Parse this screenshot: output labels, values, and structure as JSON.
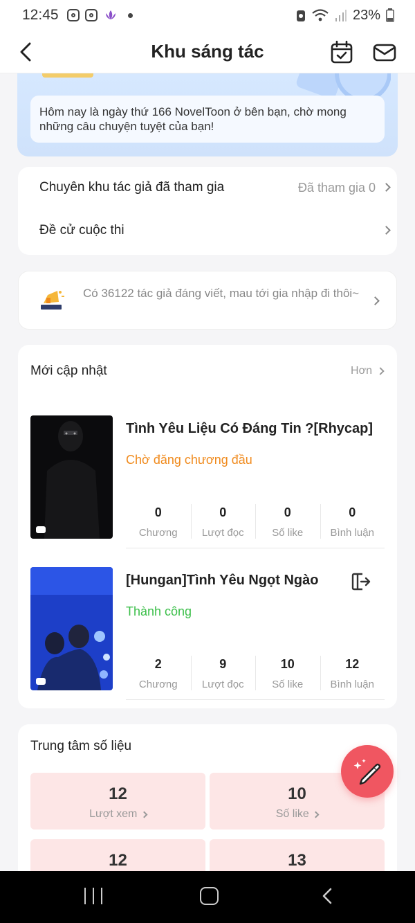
{
  "status_bar": {
    "time": "12:45",
    "battery": "23%"
  },
  "header": {
    "title": "Khu sáng tác"
  },
  "banner": {
    "message": "Hôm nay là ngày thứ 166 NovelToon ở bên bạn, chờ mong những câu chuyện tuyệt của bạn!"
  },
  "links": [
    {
      "label": "Chuyên khu tác giả đã tham gia",
      "meta": "Đã tham gia 0"
    },
    {
      "label": "Đề cử cuộc thi",
      "meta": ""
    }
  ],
  "promo": {
    "text": "Có 36122 tác giả đáng viết, mau tới gia nhập đi thôi~"
  },
  "updates": {
    "title": "Mới cập nhật",
    "more": "Hơn",
    "works": [
      {
        "title": "Tình Yêu Liệu Có Đáng Tin ?[Rhycap]",
        "status": "Chờ đăng chương đầu",
        "status_color": "#f08a1c",
        "stats": [
          {
            "num": "0",
            "label": "Chương"
          },
          {
            "num": "0",
            "label": "Lượt đọc"
          },
          {
            "num": "0",
            "label": "Số like"
          },
          {
            "num": "0",
            "label": "Bình luận"
          }
        ]
      },
      {
        "title": "[Hungan]Tình Yêu Ngọt Ngào",
        "status": "Thành công",
        "status_color": "#3cbf4a",
        "stats": [
          {
            "num": "2",
            "label": "Chương"
          },
          {
            "num": "9",
            "label": "Lượt đọc"
          },
          {
            "num": "10",
            "label": "Số like"
          },
          {
            "num": "12",
            "label": "Bình luận"
          }
        ]
      }
    ]
  },
  "data_center": {
    "title": "Trung tâm số liệu",
    "tiles": [
      {
        "num": "12",
        "label": "Lượt xem"
      },
      {
        "num": "10",
        "label": "Số like"
      },
      {
        "num": "12",
        "label": ""
      },
      {
        "num": "13",
        "label": ""
      }
    ]
  },
  "colors": {
    "accent": "#f05661",
    "tile_bg": "#fde6e6",
    "banner_bg": "#d6e8ff"
  }
}
